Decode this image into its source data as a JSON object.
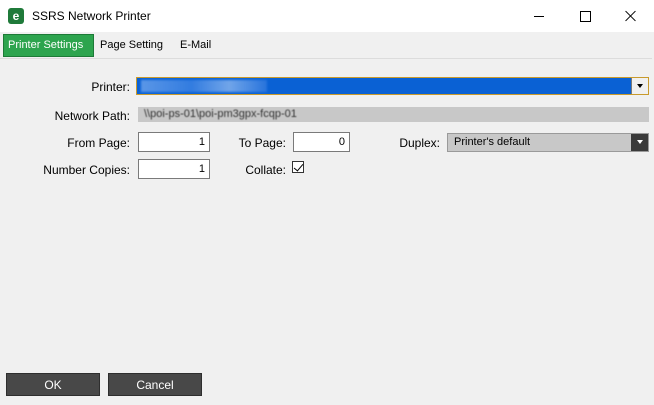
{
  "window": {
    "title": "SSRS Network Printer",
    "app_icon_letter": "e"
  },
  "tabs": [
    {
      "label": "Printer Settings",
      "active": true
    },
    {
      "label": "Page Setting",
      "active": false
    },
    {
      "label": "E-Mail",
      "active": false
    }
  ],
  "form": {
    "printer_label": "Printer:",
    "network_path_label": "Network Path:",
    "network_path_value": "\\\\poi-ps-01\\poi-pm3gpx-fcqp-01",
    "from_page_label": "From Page:",
    "from_page_value": "1",
    "to_page_label": "To Page:",
    "to_page_value": "0",
    "duplex_label": "Duplex:",
    "duplex_value": "Printer's default",
    "copies_label": "Number Copies:",
    "copies_value": "1",
    "collate_label": "Collate:",
    "collate_checked": true
  },
  "buttons": {
    "ok": "OK",
    "cancel": "Cancel"
  },
  "colors": {
    "active_tab": "#2da44e",
    "selection_blue": "#0a61d4",
    "button_dark": "#484848"
  }
}
